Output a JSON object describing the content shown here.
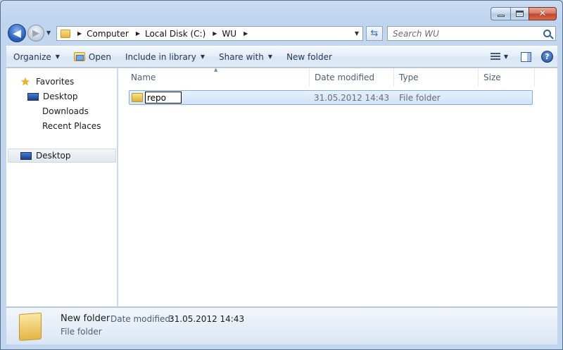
{
  "window": {
    "caption_buttons": {
      "minimize": "",
      "maximize": "",
      "close": "✕"
    }
  },
  "nav": {
    "back": "◀",
    "forward": "▶",
    "breadcrumbs": [
      "Computer",
      "Local Disk (C:)",
      "WU"
    ],
    "search_placeholder": "Search WU"
  },
  "toolbar": {
    "organize": "Organize",
    "open": "Open",
    "include_in_library": "Include in library",
    "share_with": "Share with",
    "new_folder": "New folder",
    "help": "?"
  },
  "sidebar": {
    "favorites": "Favorites",
    "items": [
      "Desktop",
      "Downloads",
      "Recent Places"
    ],
    "desktop_root": "Desktop"
  },
  "columns": {
    "name": "Name",
    "date_modified": "Date modified",
    "type": "Type",
    "size": "Size"
  },
  "files": [
    {
      "name": "repo",
      "date_modified": "31.05.2012 14:43",
      "type": "File folder",
      "size": ""
    }
  ],
  "details": {
    "name": "New folder",
    "date_label": "Date modified:",
    "date_value": "31.05.2012 14:43",
    "type": "File folder"
  },
  "colors": {
    "selection": "#cfe3f9",
    "selection_border": "#84acdd",
    "accent": "#2c63c4"
  }
}
